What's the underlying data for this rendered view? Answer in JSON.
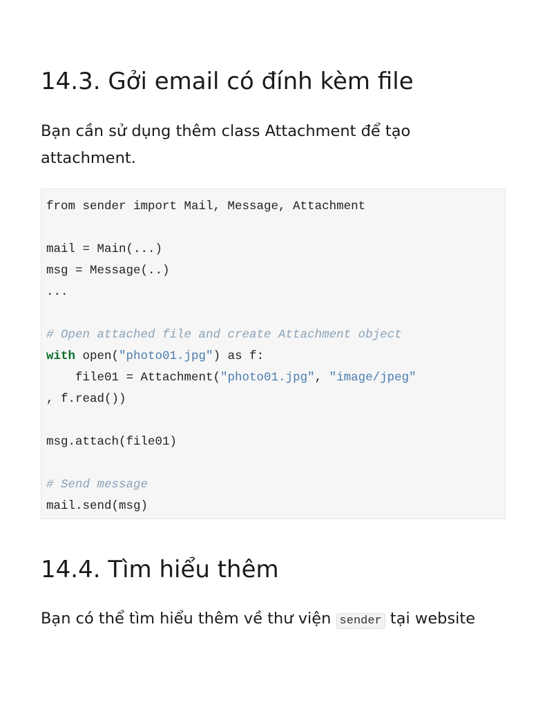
{
  "section1": {
    "title": "14.3. Gởi email có đính kèm file",
    "paragraph_line1": "Bạn cần sử dụng thêm class Attachment để tạo",
    "paragraph_line2": "attachment."
  },
  "code": {
    "lines": [
      {
        "parts": [
          {
            "t": "from sender import Mail, Message, Attachment",
            "k": "plain"
          }
        ]
      },
      {
        "parts": []
      },
      {
        "parts": [
          {
            "t": "mail = Main(...)",
            "k": "plain"
          }
        ]
      },
      {
        "parts": [
          {
            "t": "msg = Message(..)",
            "k": "plain"
          }
        ]
      },
      {
        "parts": [
          {
            "t": "...",
            "k": "plain"
          }
        ]
      },
      {
        "parts": []
      },
      {
        "parts": [
          {
            "t": "# Open attached file and create Attachment object",
            "k": "comment"
          }
        ]
      },
      {
        "parts": [
          {
            "t": "with",
            "k": "keyword"
          },
          {
            "t": " open(",
            "k": "plain"
          },
          {
            "t": "\"photo01.jpg\"",
            "k": "string"
          },
          {
            "t": ") as f:",
            "k": "plain"
          }
        ]
      },
      {
        "parts": [
          {
            "t": "    file01 = Attachment(",
            "k": "plain"
          },
          {
            "t": "\"photo01.jpg\"",
            "k": "string"
          },
          {
            "t": ", ",
            "k": "plain"
          },
          {
            "t": "\"image/jpeg\"",
            "k": "string"
          }
        ]
      },
      {
        "parts": [
          {
            "t": ", f.read())",
            "k": "plain"
          }
        ]
      },
      {
        "parts": []
      },
      {
        "parts": [
          {
            "t": "msg.attach(file01)",
            "k": "plain"
          }
        ]
      },
      {
        "parts": []
      },
      {
        "parts": [
          {
            "t": "# Send message",
            "k": "comment"
          }
        ]
      },
      {
        "parts": [
          {
            "t": "mail.send(msg)",
            "k": "plain"
          }
        ]
      }
    ]
  },
  "section2": {
    "title": "14.4. Tìm hiểu thêm",
    "paragraph_before": "Bạn có thể tìm hiểu thêm về thư viện ",
    "inline_code": "sender",
    "paragraph_after": " tại website"
  },
  "colors": {
    "comment": "#8aa2b8",
    "keyword": "#0a6d2a",
    "string": "#4a7bb0",
    "code_background": "#f6f6f6"
  }
}
